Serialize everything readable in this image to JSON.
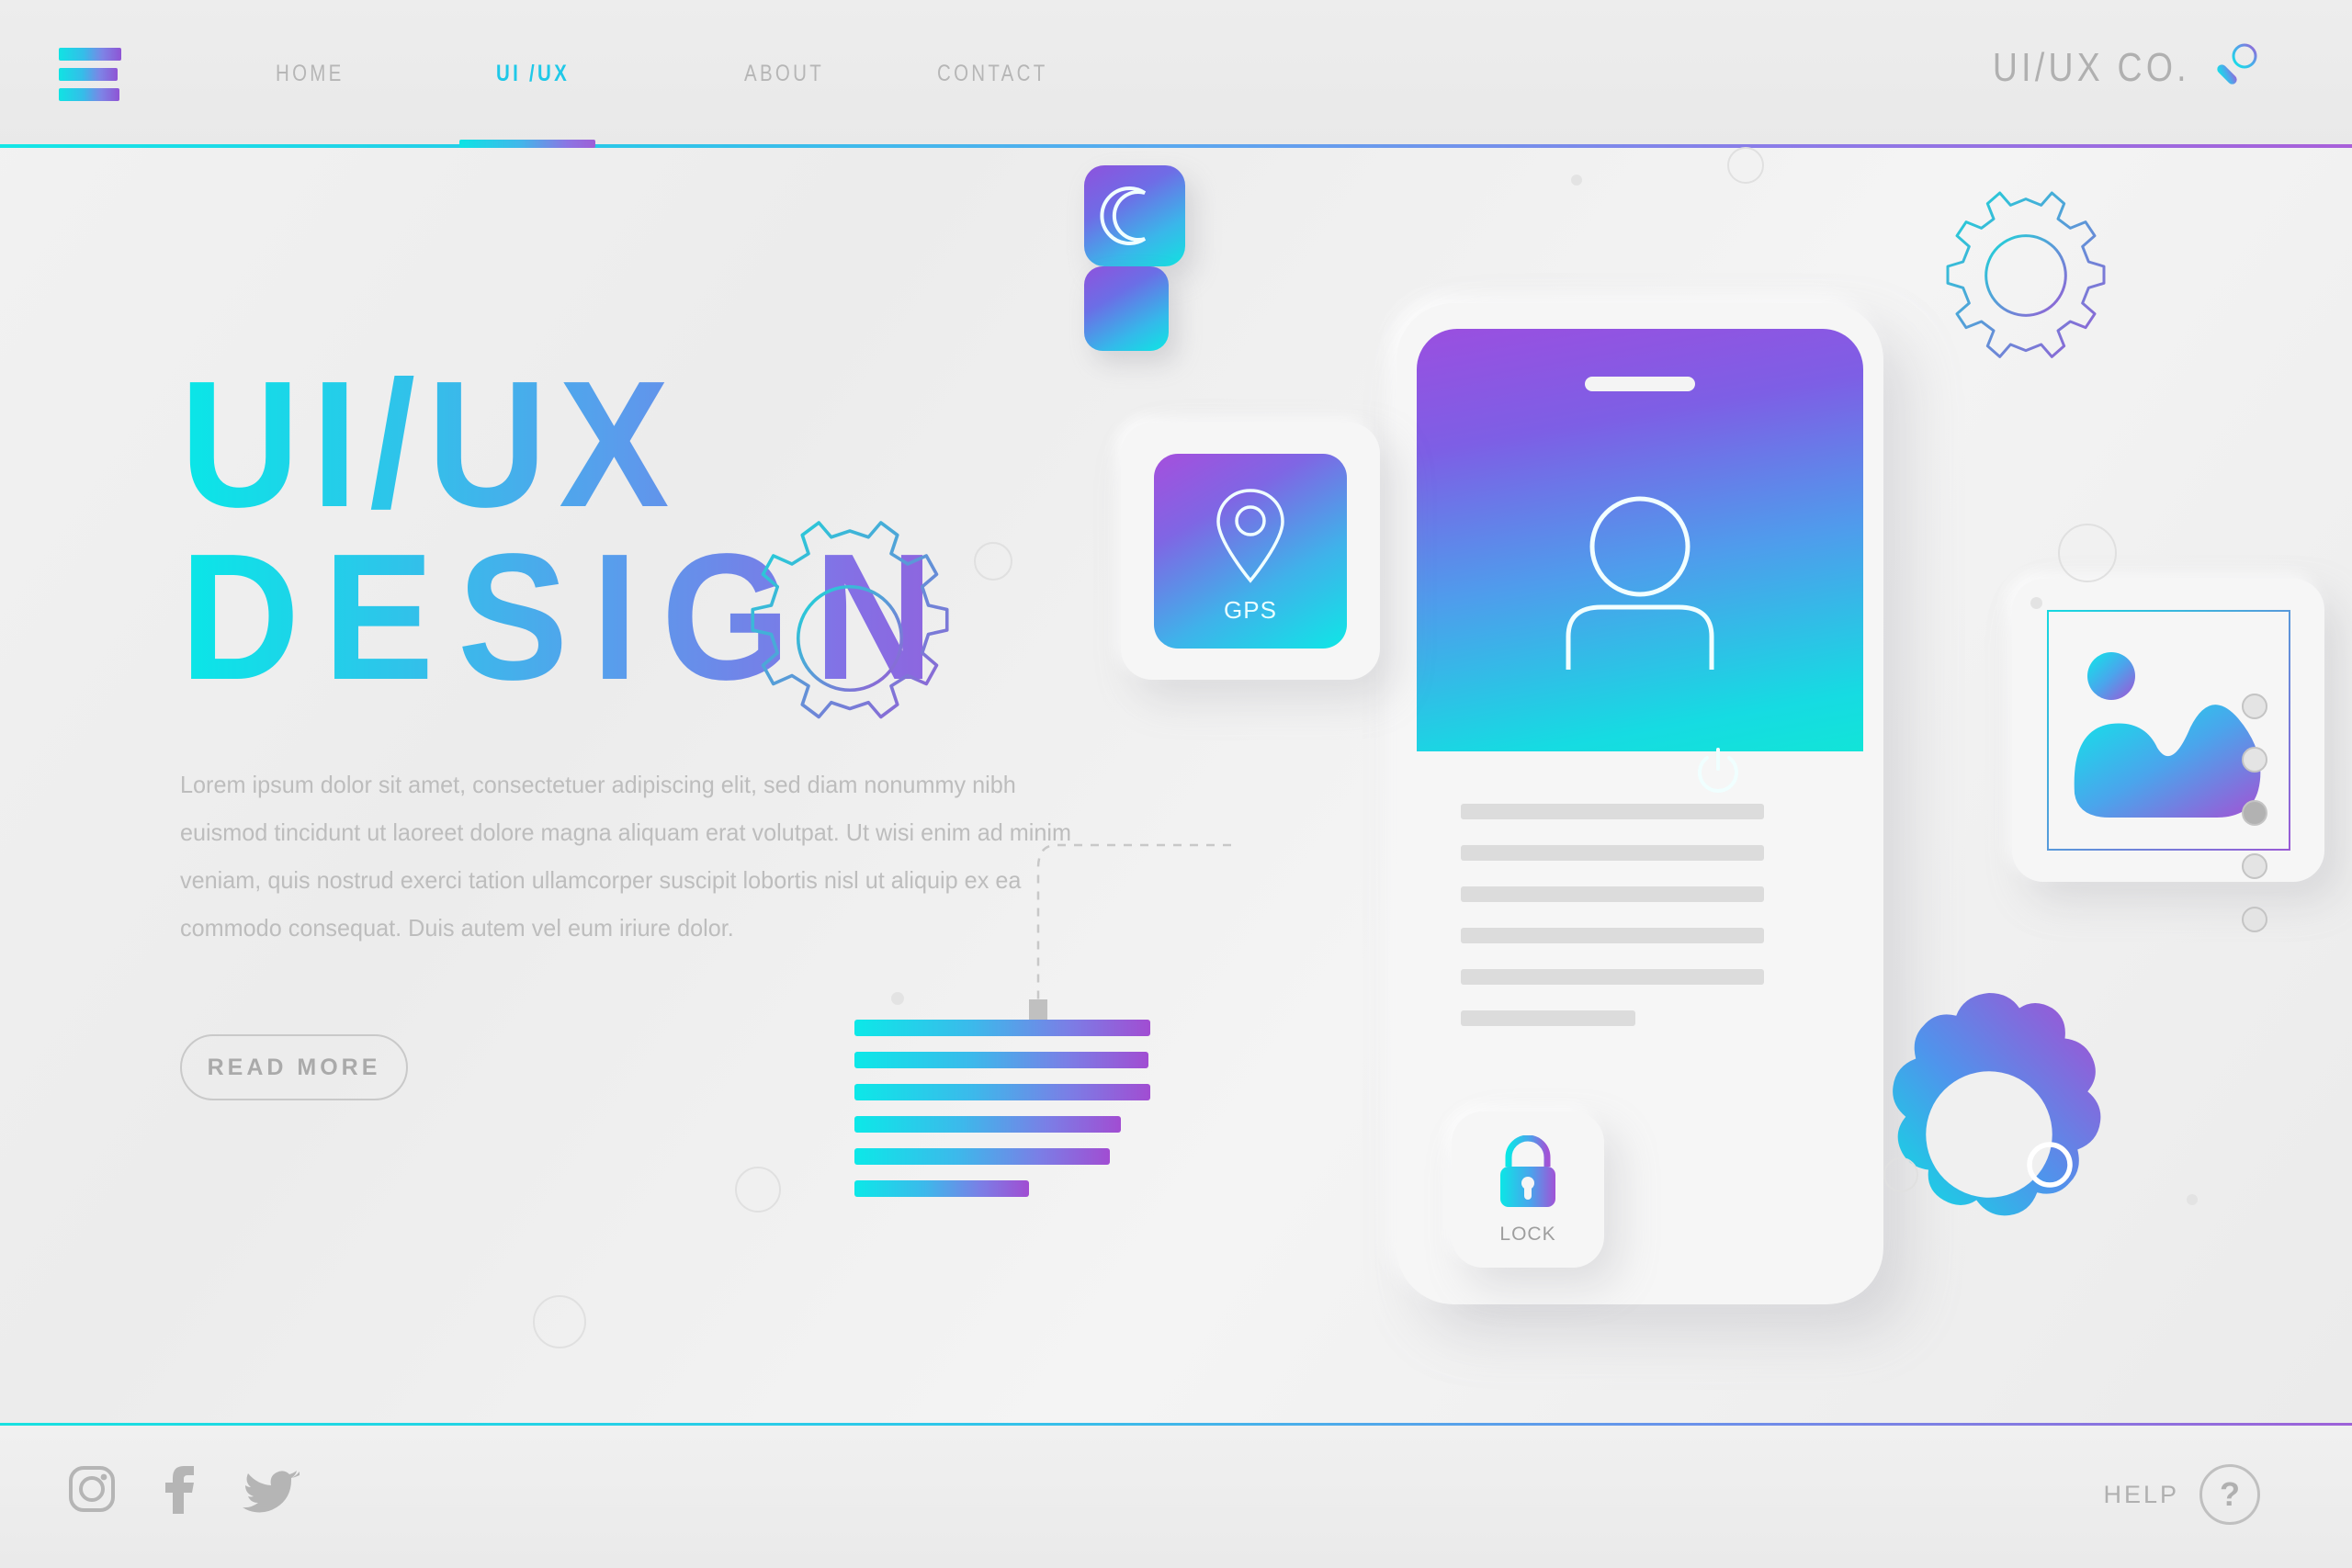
{
  "nav": {
    "menu_icon": "hamburger-icon",
    "links": [
      {
        "label": "HOME",
        "active": false
      },
      {
        "label": "UI /UX",
        "active": true
      },
      {
        "label": "ABOUT",
        "active": false
      },
      {
        "label": "CONTACT",
        "active": false
      }
    ],
    "brand": "UI/UX CO.",
    "search_icon": "magnifier-icon"
  },
  "hero": {
    "title_line1": "UI/UX",
    "title_line2": "DESIGN",
    "paragraph": "Lorem ipsum dolor sit amet, consectetuer adipiscing elit, sed diam nonummy nibh euismod tincidunt ut laoreet dolore magna aliquam erat volutpat. Ut wisi enim ad minim veniam, quis nostrud exerci tation ullamcorper suscipit lobortis nisl ut aliquip ex ea commodo consequat. Duis autem vel eum iriure dolor.",
    "cta_label": "READ MORE"
  },
  "illustration": {
    "gps_card_label": "GPS",
    "gps_icon": "location-pin-icon",
    "lock_card_label": "LOCK",
    "lock_icon": "padlock-icon",
    "moon_icon": "crescent-moon-icon",
    "power_icon": "power-button-icon",
    "image_icon": "photo-image-icon",
    "avatar_icon": "user-avatar-icon",
    "gear_icon": "gear-cog-icon"
  },
  "pagination": {
    "dots": 5,
    "active_index": 2
  },
  "footer": {
    "socials": [
      {
        "name": "instagram-icon"
      },
      {
        "name": "facebook-icon"
      },
      {
        "name": "twitter-icon"
      }
    ],
    "help_label": "HELP",
    "help_symbol": "?"
  },
  "colors": {
    "cyan": "#0ce8e8",
    "blue": "#4f9cec",
    "purple": "#a24fd0",
    "text_muted": "#bdbdbd",
    "bg": "#eeeeee"
  }
}
